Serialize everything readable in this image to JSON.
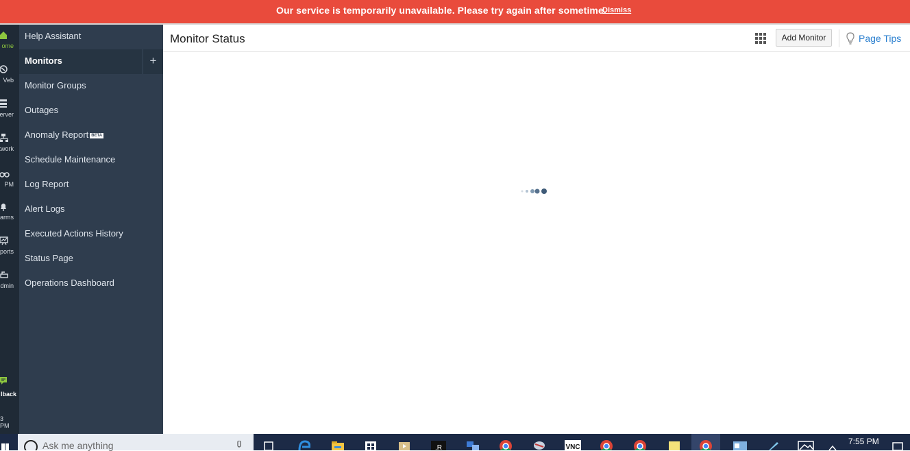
{
  "banner": {
    "message": "Our service is temporarily unavailable. Please try again after sometime.",
    "dismiss_label": "Dismiss"
  },
  "rail": {
    "items": [
      {
        "label": "ome",
        "icon": "home-icon"
      },
      {
        "label": "Veb",
        "icon": "globe-icon"
      },
      {
        "label": "erver",
        "icon": "server-icon"
      },
      {
        "label": "etwork",
        "icon": "network-icon"
      },
      {
        "label": "PM",
        "icon": "apm-binoculars-icon"
      },
      {
        "label": "arms",
        "icon": "bell-icon"
      },
      {
        "label": "ports",
        "icon": "chart-icon"
      },
      {
        "label": "dmin",
        "icon": "admin-icon"
      }
    ],
    "feedback_label": "lback",
    "time_label": "3 PM"
  },
  "menu": {
    "items": [
      {
        "label": "Help Assistant"
      },
      {
        "label": "Monitors",
        "active": true
      },
      {
        "label": "Monitor Groups"
      },
      {
        "label": "Outages"
      },
      {
        "label": "Anomaly Report",
        "badge": "BETA"
      },
      {
        "label": "Schedule Maintenance"
      },
      {
        "label": "Log Report"
      },
      {
        "label": "Alert Logs"
      },
      {
        "label": "Executed Actions History"
      },
      {
        "label": "Status Page"
      },
      {
        "label": "Operations Dashboard"
      }
    ],
    "add_symbol": "+"
  },
  "header": {
    "title": "Monitor Status",
    "add_monitor_label": "Add Monitor",
    "page_tips_label": "Page Tips"
  },
  "taskbar": {
    "search_placeholder": "Ask me anything",
    "time": "7:55 PM",
    "icons": [
      "windows-start-icon",
      "search-icon",
      "microphone-icon",
      "task-view-icon",
      "edge-icon",
      "file-explorer-icon",
      "store-icon",
      "media-player-icon",
      "app-icon",
      "network-app-icon",
      "chrome-icon",
      "app-icon",
      "vnc-icon",
      "chrome-icon",
      "chrome-icon",
      "notes-icon",
      "chrome-icon",
      "outlook-icon",
      "pen-icon",
      "photo-icon",
      "chevron-up-icon",
      "notification-icon"
    ]
  },
  "colors": {
    "banner_bg": "#e94b3c",
    "rail_bg": "#1f2a36",
    "menu_bg": "#2f3d4e",
    "accent_green": "#8dc63f",
    "link_blue": "#2a7fcf",
    "taskbar_bg": "#1c2a46"
  }
}
